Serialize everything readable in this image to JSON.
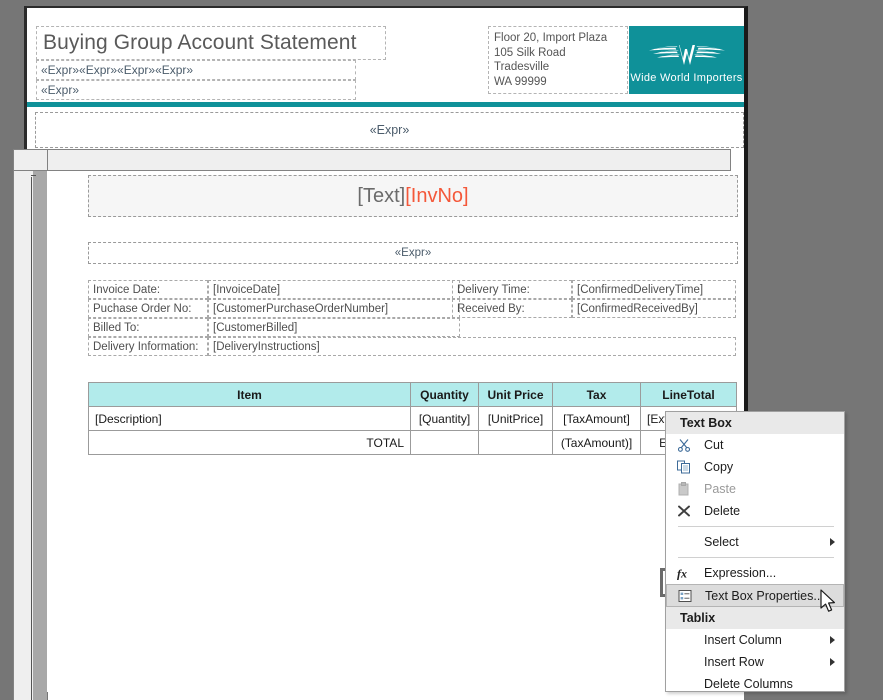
{
  "report": {
    "header": {
      "title": "Buying Group Account Statement",
      "subtitle_line1": "«Expr»«Expr»«Expr»«Expr»",
      "subtitle_line2": "«Expr»",
      "address": [
        "Floor 20, Import Plaza",
        "105 Silk Road",
        "Tradesville",
        "WA 99999"
      ],
      "logo_text": "Wide World Importers",
      "logo_bg_color": "#0f9199",
      "rule_color": "#0f9199"
    },
    "body": {
      "top_expr": "«Expr»",
      "invoice_heading": {
        "text_part": "[Text]",
        "invno_part": "[InvNo]",
        "text_color": "#6b6b6b",
        "invno_color": "#f4583a"
      },
      "second_expr": "«Expr»",
      "details": {
        "left": [
          {
            "label": "Invoice Date:",
            "value": "[InvoiceDate]"
          },
          {
            "label": "Puchase Order No:",
            "value": "[CustomerPurchaseOrderNumber]"
          },
          {
            "label": "Billed To:",
            "value": "[CustomerBilled]"
          },
          {
            "label": "Delivery Information:",
            "value": "[DeliveryInstructions]"
          }
        ],
        "right": [
          {
            "label": "Delivery Time:",
            "value": "[ConfirmedDeliveryTime]"
          },
          {
            "label": "Received By:",
            "value": "[ConfirmedReceivedBy]"
          }
        ]
      },
      "table": {
        "header_bg_color": "#b2ebeb",
        "columns": [
          "Item",
          "Quantity",
          "Unit Price",
          "Tax",
          "LineTotal"
        ],
        "rows": [
          {
            "item": "[Description]",
            "quantity": "[Quantity]",
            "unit_price": "[UnitPrice]",
            "tax": "[TaxAmount]",
            "line_total": "[ExtendedPrice]"
          }
        ],
        "total_row": {
          "label": "TOTAL",
          "quantity": "",
          "unit_price": "",
          "tax": "(TaxAmount)]",
          "line_total": "ExtendedP"
        }
      }
    }
  },
  "context_menu": {
    "groups": [
      {
        "title": "Text Box",
        "items": [
          {
            "label": "Cut",
            "icon": "scissors-icon",
            "state": "enabled",
            "submenu": false
          },
          {
            "label": "Copy",
            "icon": "copy-icon",
            "state": "enabled",
            "submenu": false
          },
          {
            "label": "Paste",
            "icon": "paste-icon",
            "state": "disabled",
            "submenu": false
          },
          {
            "label": "Delete",
            "icon": "delete-x-icon",
            "state": "enabled",
            "submenu": false
          },
          {
            "label": "SEPARATOR",
            "icon": "",
            "state": "enabled",
            "submenu": false
          },
          {
            "label": "Select",
            "icon": "",
            "state": "enabled",
            "submenu": true
          },
          {
            "label": "SEPARATOR",
            "icon": "",
            "state": "enabled",
            "submenu": false
          },
          {
            "label": "Expression...",
            "icon": "fx-icon",
            "state": "enabled",
            "submenu": false
          },
          {
            "label": "Text Box Properties...",
            "icon": "properties-icon",
            "state": "highlighted",
            "submenu": false
          }
        ]
      },
      {
        "title": "Tablix",
        "items": [
          {
            "label": "Insert Column",
            "icon": "",
            "state": "enabled",
            "submenu": true
          },
          {
            "label": "Insert Row",
            "icon": "",
            "state": "enabled",
            "submenu": true
          },
          {
            "label": "Delete Columns",
            "icon": "",
            "state": "enabled",
            "submenu": false
          }
        ]
      }
    ]
  }
}
